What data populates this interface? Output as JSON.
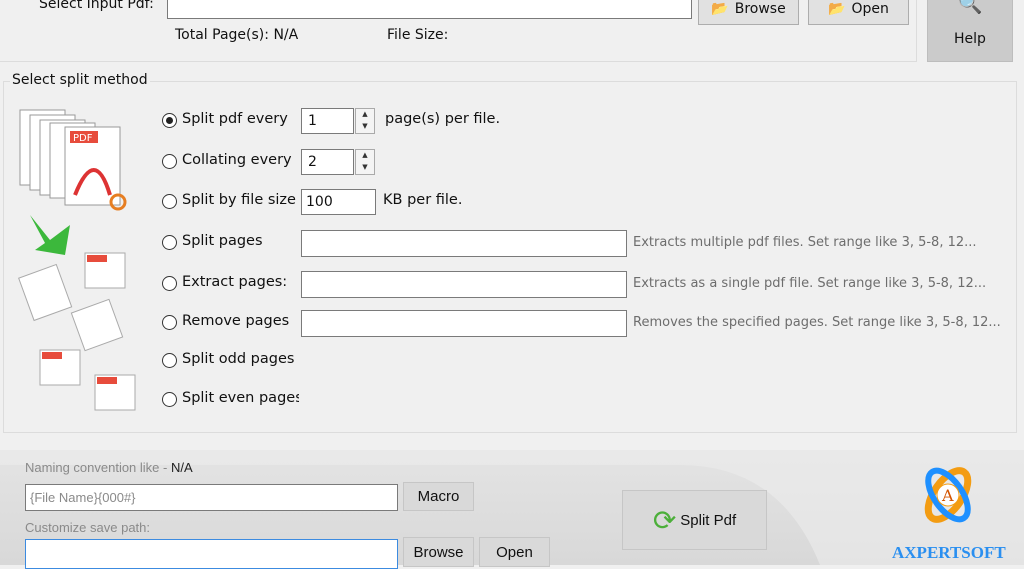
{
  "input": {
    "label": "Select Input Pdf:",
    "value": "",
    "browse": "Browse",
    "open": "Open",
    "total_pages_label": "Total Page(s):",
    "total_pages": "N/A",
    "file_size_label": "File Size:",
    "file_size": ""
  },
  "help": "Help",
  "split": {
    "title": "Select split method",
    "options": [
      {
        "label": "Split pdf every",
        "value": "1",
        "suffix": "page(s) per file.",
        "selected": true
      },
      {
        "label": "Collating every",
        "value": "2"
      },
      {
        "label": "Split by file size",
        "value": "100",
        "suffix": "KB per file."
      },
      {
        "label": "Split pages",
        "value": "",
        "hint": "Extracts multiple pdf files. Set range like 3, 5-8, 12..."
      },
      {
        "label": "Extract pages:",
        "value": "",
        "hint": "Extracts as a single pdf file. Set range like 3, 5-8, 12..."
      },
      {
        "label": "Remove pages",
        "value": "",
        "hint": "Removes the specified pages. Set range like 3, 5-8, 12..."
      },
      {
        "label": "Split odd pages"
      },
      {
        "label": "Split even pages"
      }
    ]
  },
  "output": {
    "naming_label": "Naming convention like - ",
    "naming_value": "N/A",
    "naming_input": "{File Name}{000#}",
    "macro": "Macro",
    "save_label": "Customize save path:",
    "save_path": "",
    "browse": "Browse",
    "open": "Open",
    "split_button": "Split Pdf"
  },
  "brand": {
    "name": "AXPERTSOFT",
    "colors": {
      "orange": "#f39c12",
      "blue": "#1e90ff"
    }
  }
}
